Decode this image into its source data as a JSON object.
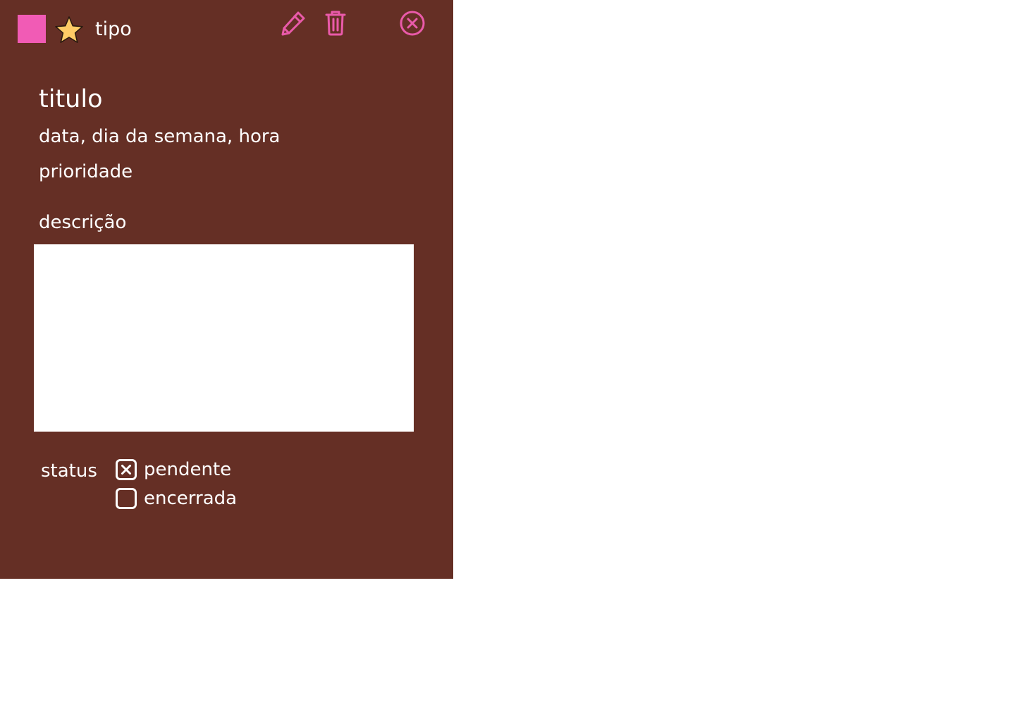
{
  "header": {
    "type_label": "tipo",
    "swatch_color": "#f15bb5",
    "icons": {
      "favorite": "star-icon",
      "edit": "pencil-icon",
      "delete": "trash-icon",
      "close": "close-circle-icon"
    },
    "accent_color": "#e95aa9"
  },
  "task": {
    "title": "titulo",
    "datetime": "data, dia da semana, hora",
    "priority": "prioridade"
  },
  "description": {
    "label": "descrição",
    "value": ""
  },
  "status": {
    "label": "status",
    "options": [
      {
        "label": "pendente",
        "checked": true
      },
      {
        "label": "encerrada",
        "checked": false
      }
    ]
  },
  "colors": {
    "panel_background": "#652f25",
    "text": "#ffffff",
    "page_background": "#ffffff"
  }
}
